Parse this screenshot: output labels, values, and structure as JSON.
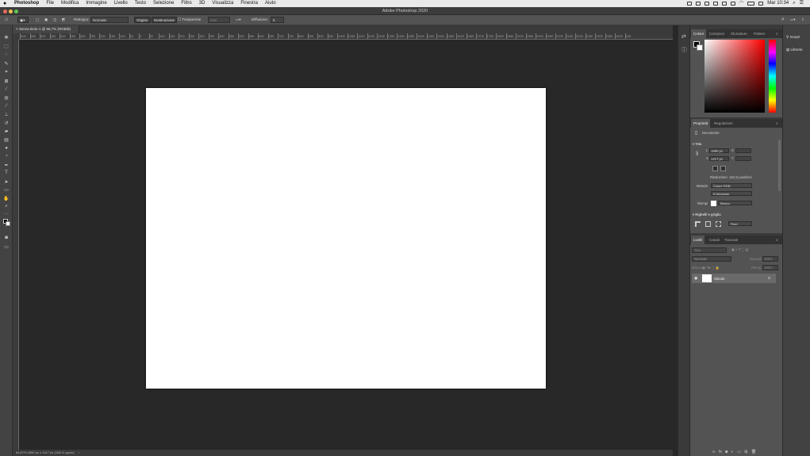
{
  "menubar": {
    "apple": "",
    "app": "Photoshop",
    "items": [
      "File",
      "Modifica",
      "Immagine",
      "Livello",
      "Testo",
      "Selezione",
      "Filtro",
      "3D",
      "Visualizza",
      "Finestra",
      "Aiuto"
    ],
    "clock": "Mar 10:34"
  },
  "window": {
    "title": "Adobe Photoshop 2020"
  },
  "options": {
    "ritoccare_label": "Rattoppo:",
    "mode_value": "Normale",
    "origine": "Origine",
    "destinazione": "Destinazione",
    "trasparente": "Trasparente",
    "usa_pattern": "Usa pattern",
    "diffusione_label": "Diffusione:",
    "diffusione_value": "5"
  },
  "document": {
    "tab_title": "Senza titolo-1 @ 66,7% (RGB/8)",
    "status": "66,67%      1890 px x 1417 px (118,11 ppcm)"
  },
  "ruler_labels": [
    "600",
    "550",
    "500",
    "450",
    "400",
    "350",
    "300",
    "250",
    "200",
    "150",
    "100",
    "50",
    "0",
    "50",
    "100",
    "150",
    "200",
    "250",
    "300",
    "350",
    "400",
    "450",
    "500",
    "550",
    "600",
    "650",
    "700",
    "750",
    "800",
    "850",
    "900",
    "950",
    "1000",
    "1050",
    "1100",
    "1150",
    "1200",
    "1250",
    "1300",
    "1350",
    "1400",
    "1450",
    "1500",
    "1550",
    "1600",
    "1650",
    "1700",
    "1750",
    "1800",
    "1850",
    "1900",
    "1950",
    "2000",
    "2050",
    "2100",
    "2150",
    "2200",
    "2250",
    "2300",
    "2350",
    "2400",
    "245"
  ],
  "color_panel": {
    "tabs": [
      "Colore",
      "Campioni",
      "Sfumature",
      "Pattern"
    ],
    "active": "Colore"
  },
  "properties_panel": {
    "tabs": [
      "Proprietà",
      "Regolazioni"
    ],
    "doc_label": "Documento",
    "section_tela": "Tela",
    "width_label": "L",
    "width_value": "1890 px",
    "x_label": "X",
    "height_label": "A",
    "height_value": "1417 px",
    "y_label": "Y",
    "resolution": "Risoluzione: 118,11 pixel/cm",
    "metodo_label": "Metodo",
    "metodo_value": "Colore RGB",
    "bit_value": "8 bit/canale",
    "riempi_label": "Riempi",
    "riempi_value": "Bianco",
    "section_grid": "Righelli e griglia",
    "units_value": "Pixel"
  },
  "layers_panel": {
    "tabs": [
      "Livelli",
      "Canali",
      "Tracciati"
    ],
    "search_placeholder": "Tipo",
    "blend_mode": "Normale",
    "opacity_label": "Opacità:",
    "opacity_value": "100%",
    "lock_label": "Blocca:",
    "fill_label": "Riemp.:",
    "fill_value": "100%",
    "layer_name": "Sfondo"
  },
  "right_dock": {
    "scopri": "Scopri",
    "librerie": "Librerie"
  },
  "colors": {
    "canvas": "#ffffff",
    "workspace": "#282828"
  }
}
